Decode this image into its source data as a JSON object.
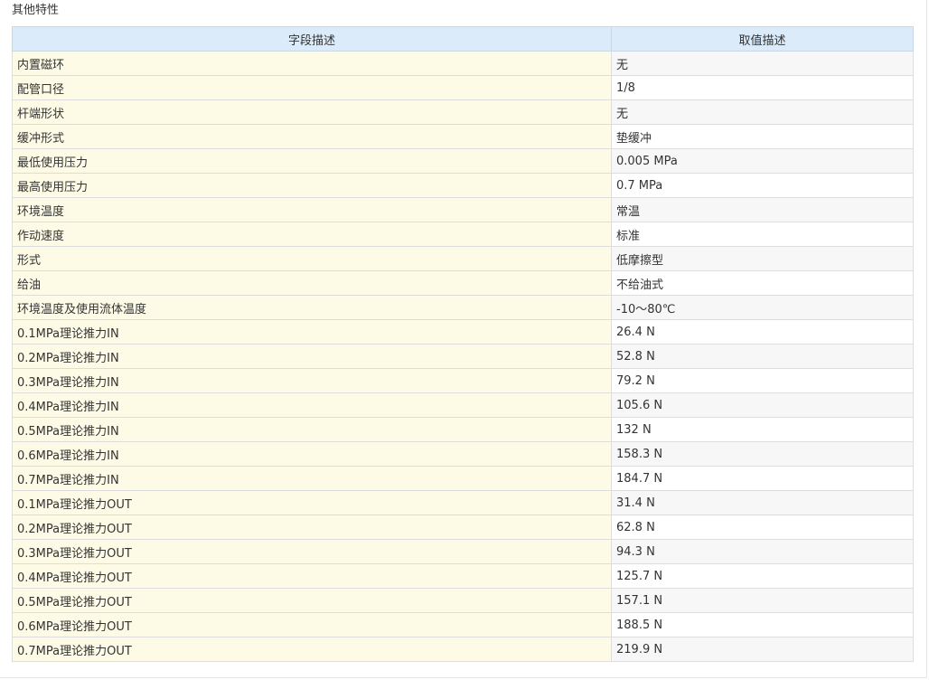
{
  "section_title": "其他特性",
  "table": {
    "headers": [
      "字段描述",
      "取值描述"
    ],
    "rows": [
      {
        "field": "内置磁环",
        "value": "无"
      },
      {
        "field": "配管口径",
        "value": "1/8"
      },
      {
        "field": "杆端形状",
        "value": "无"
      },
      {
        "field": "缓冲形式",
        "value": "垫缓冲"
      },
      {
        "field": "最低使用压力",
        "value": "0.005 MPa"
      },
      {
        "field": "最高使用压力",
        "value": "0.7 MPa"
      },
      {
        "field": "环境温度",
        "value": "常温"
      },
      {
        "field": "作动速度",
        "value": "标准"
      },
      {
        "field": "形式",
        "value": "低摩擦型"
      },
      {
        "field": "给油",
        "value": "不给油式"
      },
      {
        "field": "环境温度及使用流体温度",
        "value": "-10～80℃"
      },
      {
        "field": "0.1MPa理论推力IN",
        "value": "26.4 N"
      },
      {
        "field": "0.2MPa理论推力IN",
        "value": "52.8 N"
      },
      {
        "field": "0.3MPa理论推力IN",
        "value": "79.2 N"
      },
      {
        "field": "0.4MPa理论推力IN",
        "value": "105.6 N"
      },
      {
        "field": "0.5MPa理论推力IN",
        "value": "132 N"
      },
      {
        "field": "0.6MPa理论推力IN",
        "value": "158.3 N"
      },
      {
        "field": "0.7MPa理论推力IN",
        "value": "184.7 N"
      },
      {
        "field": "0.1MPa理论推力OUT",
        "value": "31.4 N"
      },
      {
        "field": "0.2MPa理论推力OUT",
        "value": "62.8 N"
      },
      {
        "field": "0.3MPa理论推力OUT",
        "value": "94.3 N"
      },
      {
        "field": "0.4MPa理论推力OUT",
        "value": "125.7 N"
      },
      {
        "field": "0.5MPa理论推力OUT",
        "value": "157.1 N"
      },
      {
        "field": "0.6MPa理论推力OUT",
        "value": "188.5 N"
      },
      {
        "field": "0.7MPa理论推力OUT",
        "value": "219.9 N"
      }
    ]
  }
}
